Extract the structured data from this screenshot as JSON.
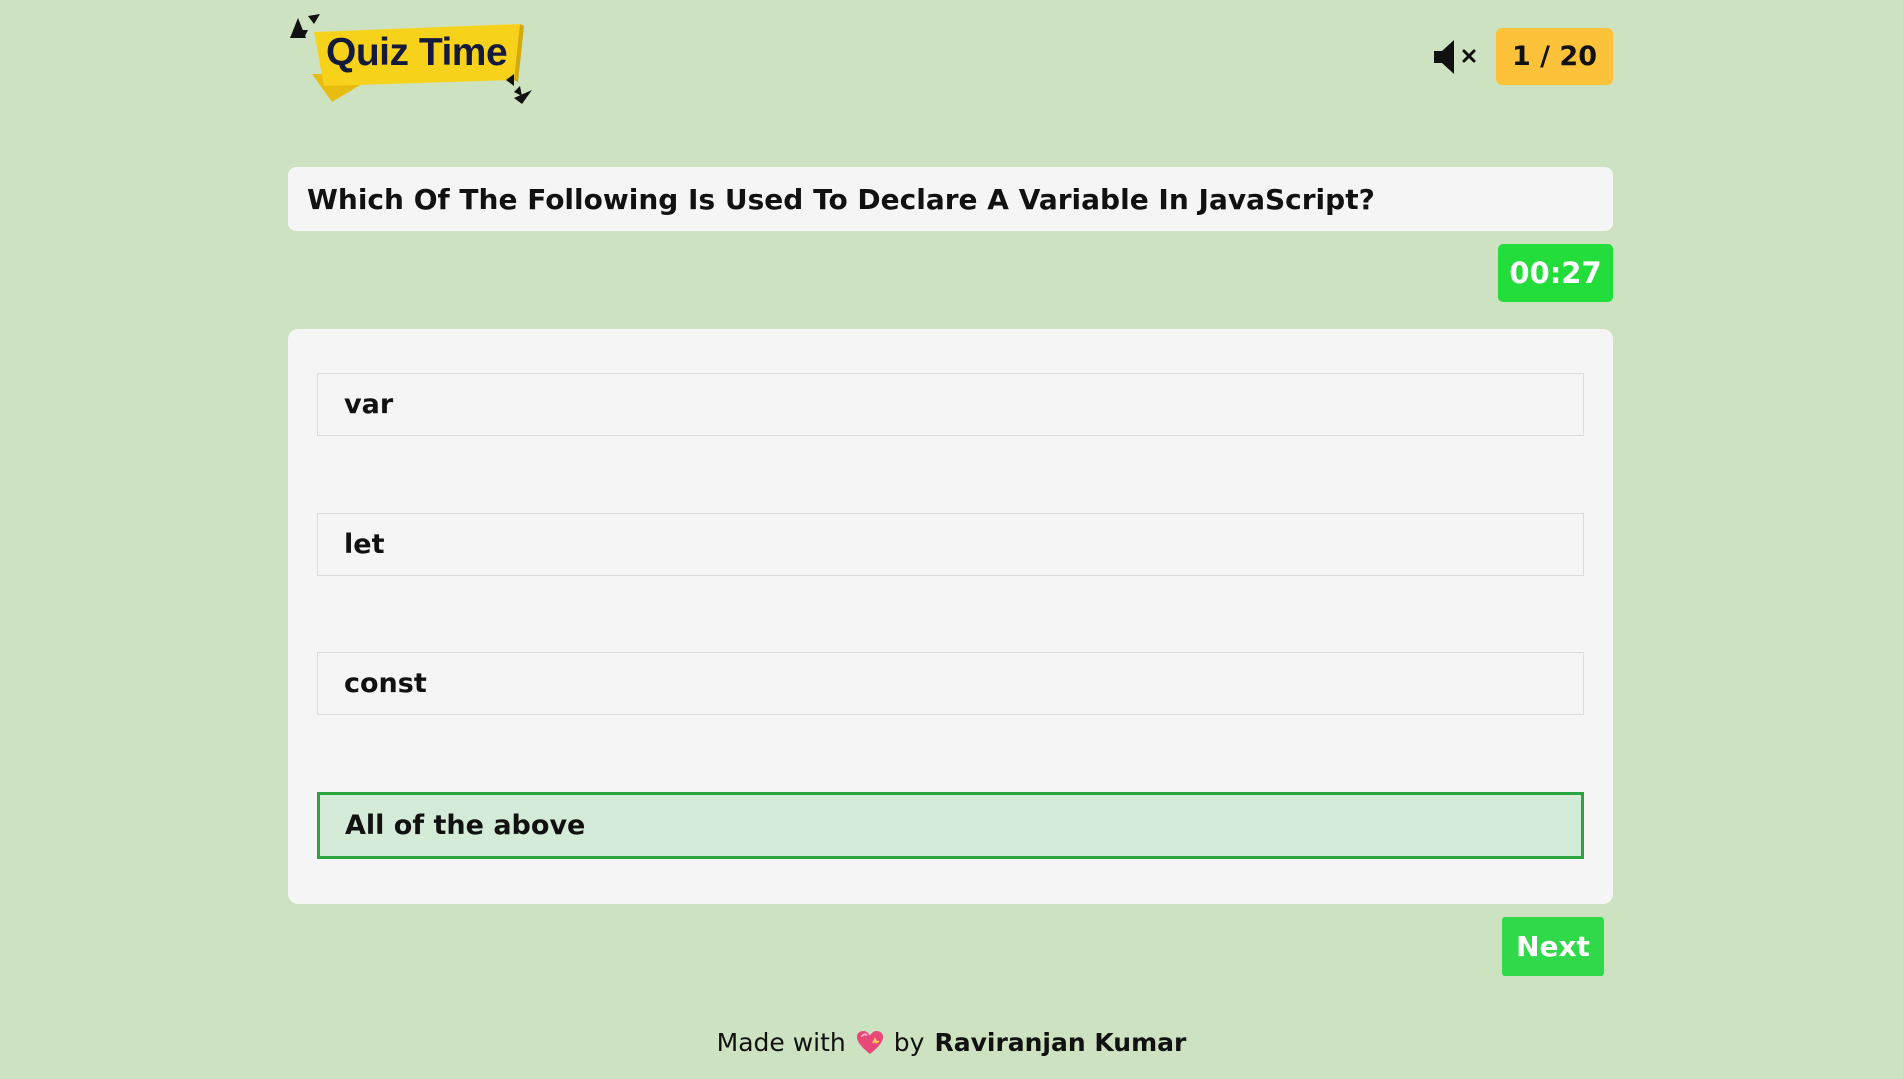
{
  "header": {
    "logo_text": "Quiz Time",
    "mute_icon": "speaker-muted-icon",
    "counter_text": "1 / 20"
  },
  "question": {
    "text": "Which Of The Following Is Used To Declare A Variable In JavaScript?"
  },
  "timer": {
    "text": "00:27"
  },
  "options": [
    {
      "label": "var",
      "selected": false
    },
    {
      "label": "let",
      "selected": false
    },
    {
      "label": "const",
      "selected": false
    },
    {
      "label": "All of the above",
      "selected": true
    }
  ],
  "next_button": {
    "label": "Next"
  },
  "footer": {
    "made_with": "Made with",
    "heart_icon": "heart-icon",
    "by": "by",
    "author": "Raviranjan Kumar"
  },
  "colors": {
    "background": "#cde2c1",
    "counter": "#fcc23a",
    "timer": "#22dd3a",
    "selected_border": "#2aa640",
    "selected_bg": "#d4ebd8",
    "next_button": "#2fd94a"
  }
}
